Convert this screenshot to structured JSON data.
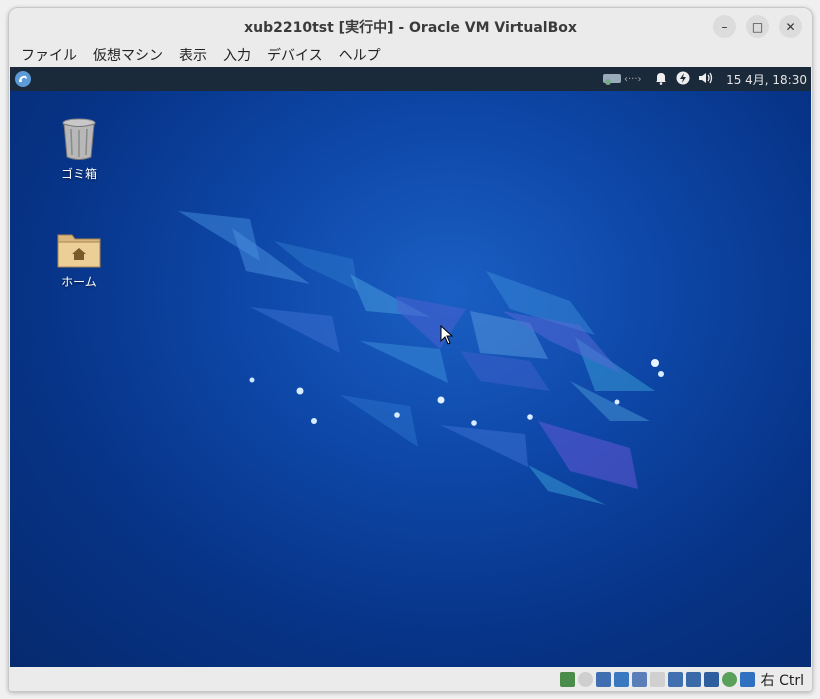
{
  "window": {
    "title": "xub2210tst [実行中] - Oracle VM VirtualBox",
    "controls": {
      "minimize": "–",
      "maximize": "□",
      "close": "✕"
    }
  },
  "menubar": {
    "items": [
      {
        "label": "ファイル"
      },
      {
        "label": "仮想マシン"
      },
      {
        "label": "表示"
      },
      {
        "label": "入力"
      },
      {
        "label": "デバイス"
      },
      {
        "label": "ヘルプ"
      }
    ]
  },
  "guest_panel": {
    "launcher_icon": "xfce-mouse-icon",
    "tray": {
      "network_icon": "network-disconnected-icon",
      "notifications_icon": "bell-icon",
      "power_icon": "power-icon",
      "volume_icon": "speaker-icon",
      "clock": "15 4月, 18:30"
    }
  },
  "desktop": {
    "icons": [
      {
        "label": "ゴミ箱",
        "icon": "trash-icon"
      },
      {
        "label": "ホーム",
        "icon": "home-folder-icon"
      }
    ],
    "background_color": "#0a3a8e"
  },
  "statusbar": {
    "icons": [
      "hard-disk-icon",
      "optical-drive-icon",
      "audio-icon",
      "network-icon",
      "usb-icon",
      "shared-folders-icon",
      "display-icon",
      "recording-icon",
      "virtualization-icon",
      "mouse-integration-icon",
      "keyboard-icon"
    ],
    "host_key": "右 Ctrl"
  }
}
